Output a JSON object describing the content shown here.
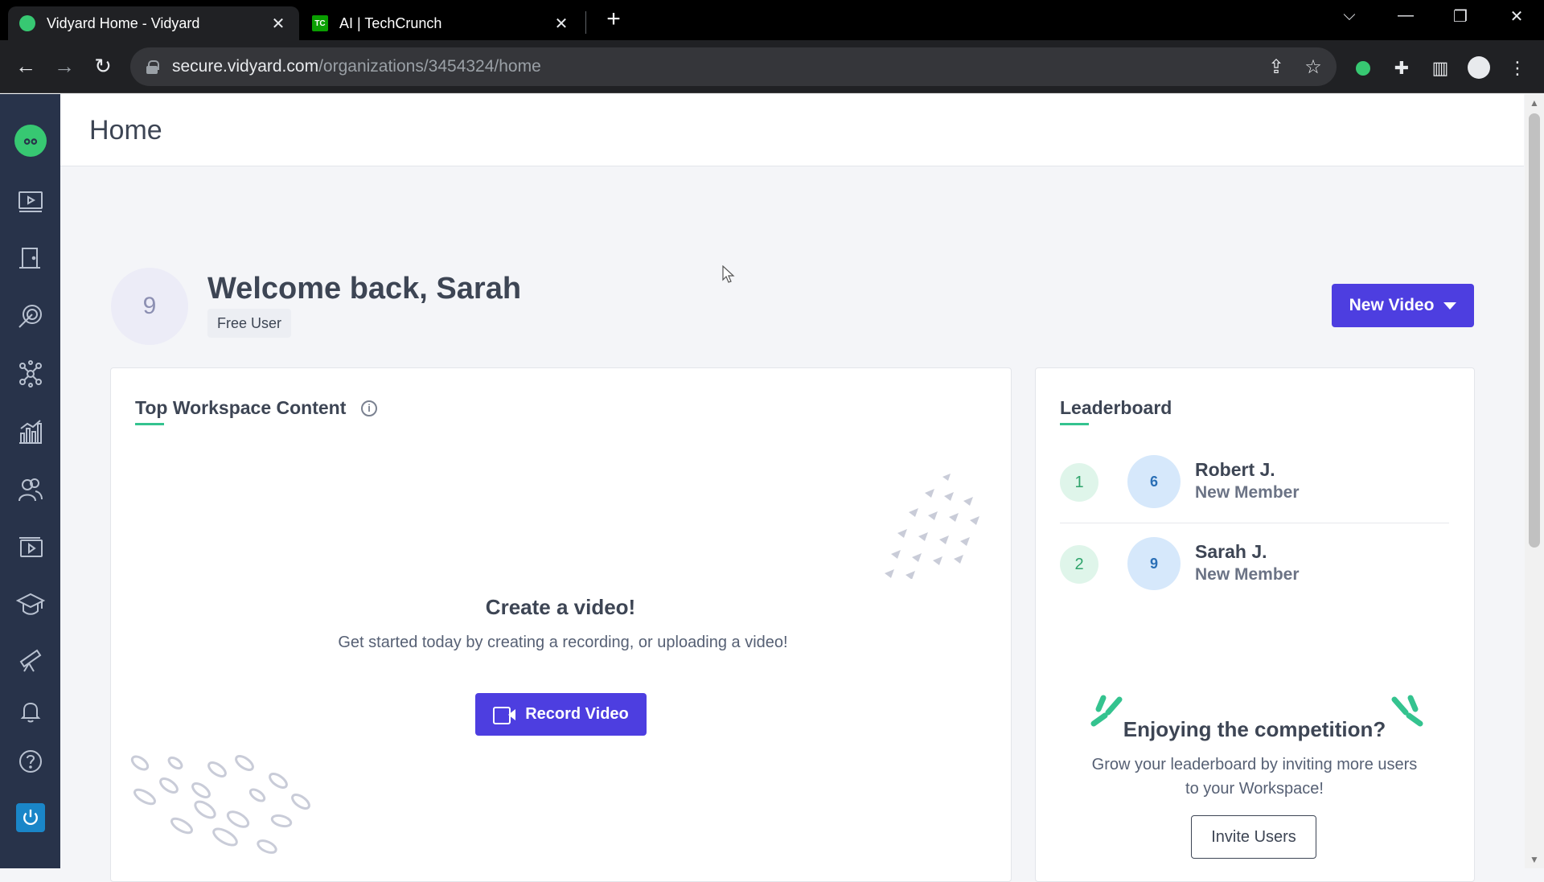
{
  "browser": {
    "tabs": [
      {
        "title": "Vidyard Home - Vidyard",
        "active": true,
        "favicon_color": "#37c872"
      },
      {
        "title": "AI | TechCrunch",
        "active": false,
        "favicon_color": "#0a9e01",
        "favicon_text": "TC"
      }
    ],
    "url_host": "secure.vidyard.com",
    "url_path": "/organizations/3454324/home"
  },
  "page": {
    "title": "Home"
  },
  "user": {
    "avatar_initial": "9",
    "welcome": "Welcome back, Sarah",
    "plan_badge": "Free User"
  },
  "actions": {
    "new_video": "New Video",
    "record_video": "Record Video",
    "invite_users": "Invite Users"
  },
  "top_content": {
    "title": "Top Workspace Content",
    "empty_title": "Create a video!",
    "empty_desc": "Get started today by creating a recording, or uploading a video!"
  },
  "leaderboard": {
    "title": "Leaderboard",
    "entries": [
      {
        "rank": "1",
        "avatar": "6",
        "name": "Robert J.",
        "role": "New Member"
      },
      {
        "rank": "2",
        "avatar": "9",
        "name": "Sarah J.",
        "role": "New Member"
      }
    ],
    "promo_title": "Enjoying the competition?",
    "promo_desc": "Grow your leaderboard by inviting more users to your Workspace!"
  },
  "colors": {
    "sidebar": "#28334a",
    "primary": "#4d3ee0",
    "accent_green": "#34c38f"
  }
}
